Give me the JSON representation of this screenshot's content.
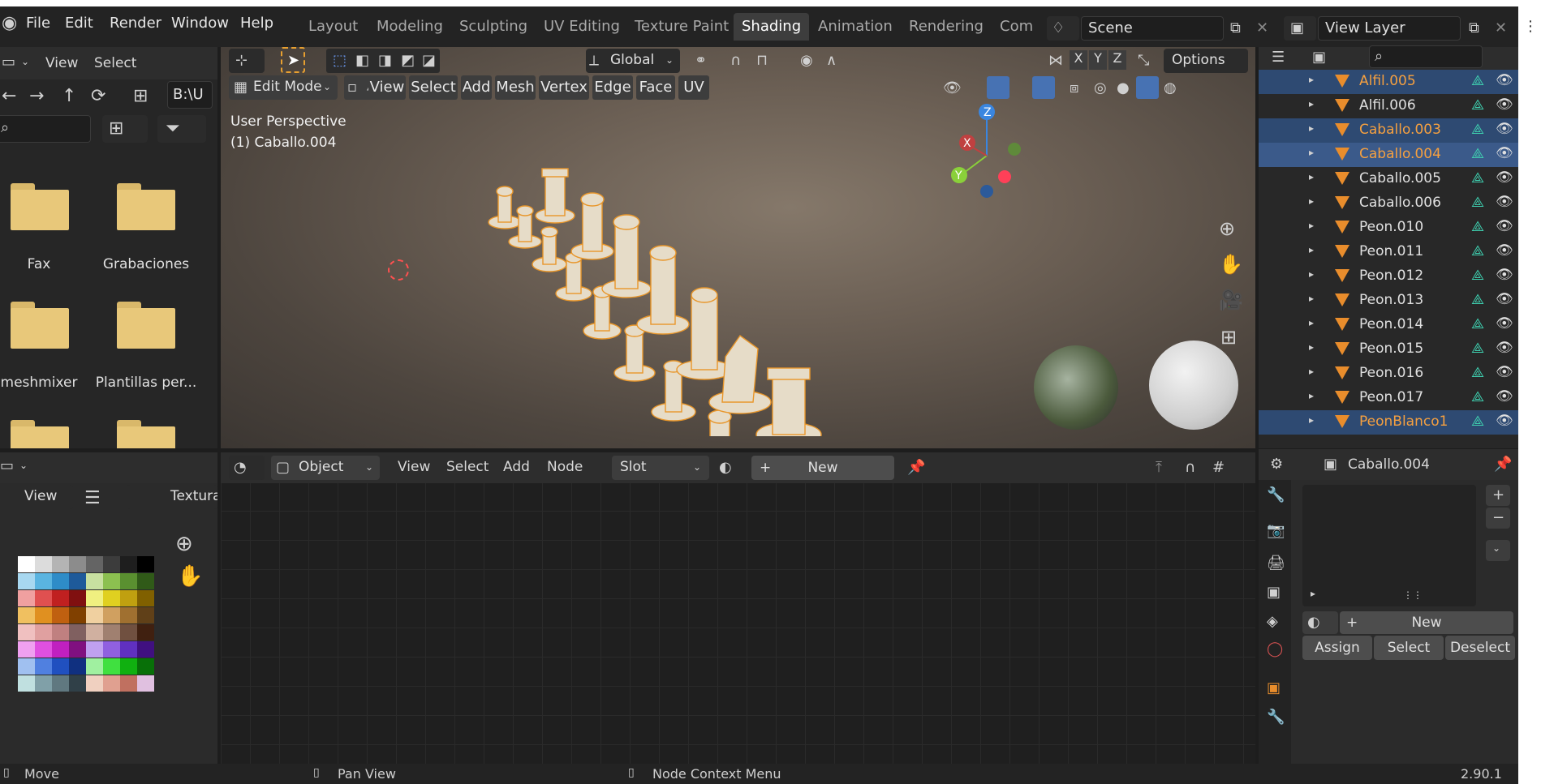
{
  "topbar": {
    "menus": [
      "File",
      "Edit",
      "Render",
      "Window",
      "Help"
    ],
    "workspaces": [
      "Layout",
      "Modeling",
      "Sculpting",
      "UV Editing",
      "Texture Paint",
      "Shading",
      "Animation",
      "Rendering",
      "Comp"
    ],
    "active_workspace": "Shading",
    "scene": "Scene",
    "view_layer": "View Layer"
  },
  "filebrowser": {
    "view_label": "View",
    "select_label": "Select",
    "path": "B:\\U",
    "folders": [
      "Fax",
      "Grabaciones",
      "meshmixer",
      "Plantillas per..."
    ]
  },
  "imageeditor": {
    "view_label": "View",
    "texture_label": "Textura"
  },
  "viewport": {
    "orientation": "Global",
    "options": "Options",
    "mode": "Edit Mode",
    "menus": [
      "View",
      "Select",
      "Add",
      "Mesh",
      "Vertex",
      "Edge",
      "Face",
      "UV"
    ],
    "perspective": "User Perspective",
    "active_object": "(1) Caballo.004",
    "axes": [
      "X",
      "Y",
      "Z"
    ],
    "gizmo_axes": [
      "Z",
      "X",
      "Y"
    ]
  },
  "node_editor": {
    "type": "Object",
    "menus": [
      "View",
      "Select",
      "Add",
      "Node"
    ],
    "slot": "Slot",
    "new_label": "New"
  },
  "outliner": {
    "items": [
      {
        "name": "Alfil.005",
        "state": "selected"
      },
      {
        "name": "Alfil.006",
        "state": "normal"
      },
      {
        "name": "Caballo.003",
        "state": "selected"
      },
      {
        "name": "Caballo.004",
        "state": "active"
      },
      {
        "name": "Caballo.005",
        "state": "normal"
      },
      {
        "name": "Caballo.006",
        "state": "normal"
      },
      {
        "name": "Peon.010",
        "state": "normal"
      },
      {
        "name": "Peon.011",
        "state": "normal"
      },
      {
        "name": "Peon.012",
        "state": "normal"
      },
      {
        "name": "Peon.013",
        "state": "normal"
      },
      {
        "name": "Peon.014",
        "state": "normal"
      },
      {
        "name": "Peon.015",
        "state": "normal"
      },
      {
        "name": "Peon.016",
        "state": "normal"
      },
      {
        "name": "Peon.017",
        "state": "normal"
      },
      {
        "name": "PeonBlanco1",
        "state": "selected"
      }
    ]
  },
  "properties": {
    "object_name": "Caballo.004",
    "new_label": "New",
    "assign_label": "Assign",
    "select_label": "Select",
    "deselect_label": "Deselect"
  },
  "statusbar": {
    "move": "Move",
    "pan_view": "Pan View",
    "context_menu": "Node Context Menu",
    "version": "2.90.1"
  },
  "colors": {
    "accent_blue": "#4772b3",
    "selection_orange": "#f5a040",
    "mesh_teal": "#3fd0b0"
  }
}
